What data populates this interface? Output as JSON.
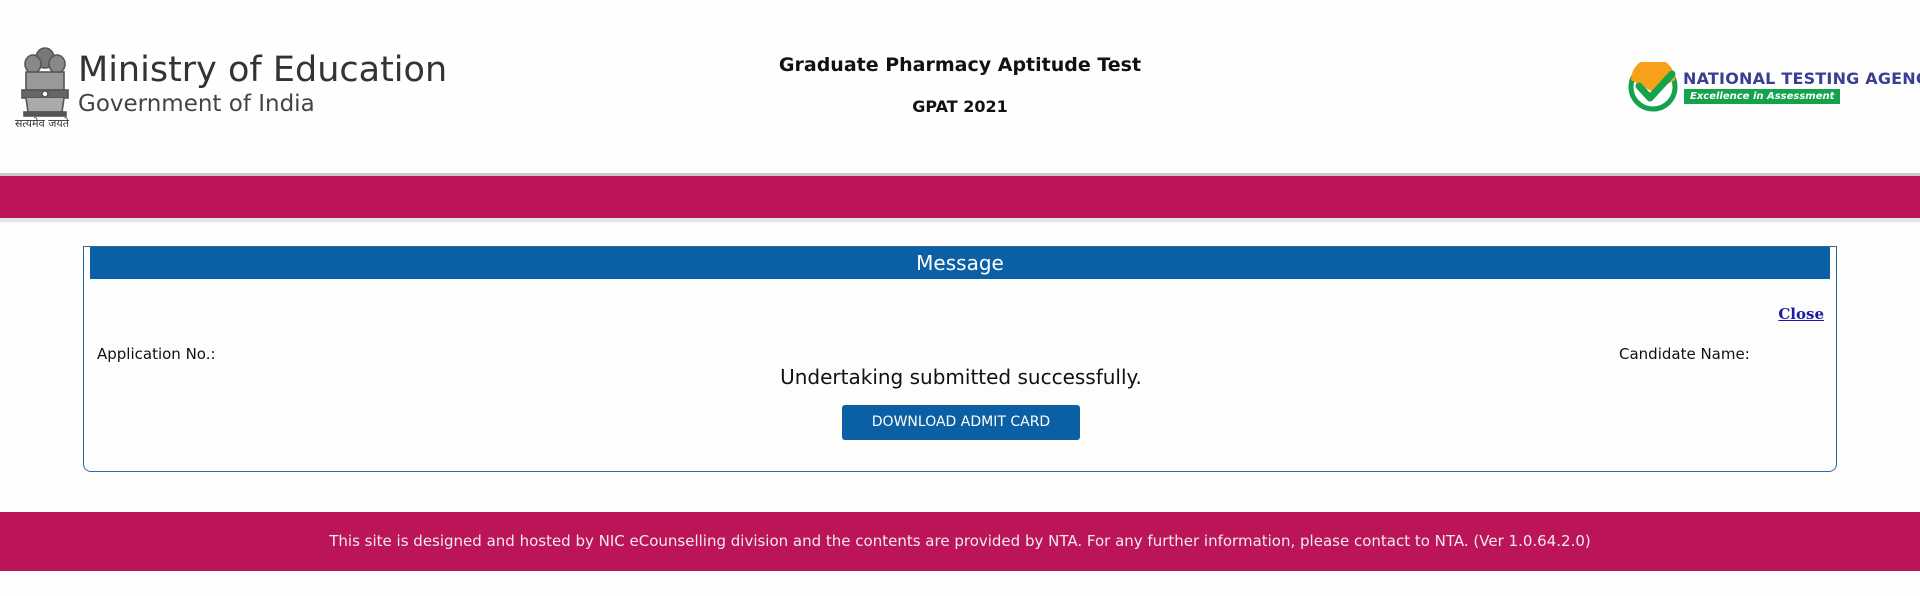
{
  "header": {
    "ministry_title": "Ministry of Education",
    "ministry_subtitle": "Government of India",
    "emblem_motto": "सत्यमेव जयते",
    "exam_title": "Graduate Pharmacy Aptitude Test",
    "exam_subtitle": "GPAT 2021",
    "agency_name": "NATIONAL TESTING AGENCY",
    "agency_tagline": "Excellence in Assessment"
  },
  "message_panel": {
    "heading": "Message",
    "close_label": "Close",
    "application_label": "Application No.:",
    "candidate_label": "Candidate Name:",
    "success_text": "Undertaking submitted successfully.",
    "download_button": "DOWNLOAD ADMIT CARD"
  },
  "footer": {
    "text": "This site is designed and hosted by NIC eCounselling division and the contents are provided by NTA. For any further information, please contact to NTA. (Ver 1.0.64.2.0)"
  },
  "icons": {
    "emblem": "national-emblem-icon",
    "agency_logo": "nta-checkmark-logo-icon"
  },
  "colors": {
    "brand_magenta": "#bb1458",
    "header_blue": "#0b5fa5",
    "agency_green": "#15a24d",
    "agency_navy": "#3b3f93",
    "agency_orange": "#f7a11a"
  }
}
